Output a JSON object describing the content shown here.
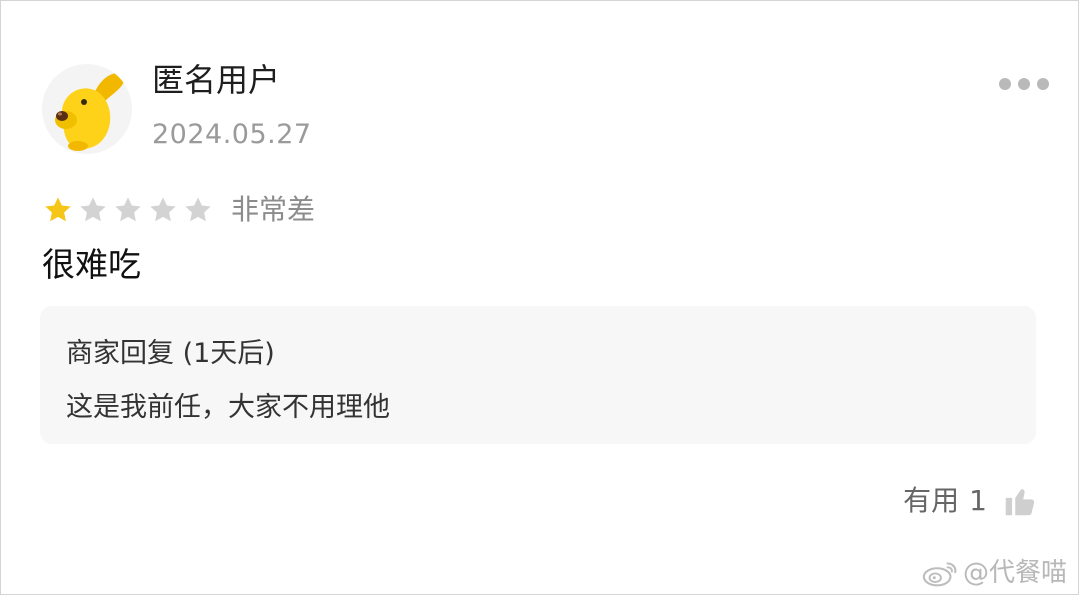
{
  "review": {
    "user_name": "匿名用户",
    "date": "2024.05.27",
    "avatar_icon": "yellow-dog-mascot-icon",
    "more_icon": "more-dots-icon",
    "rating": {
      "filled_stars": 1,
      "total_stars": 5,
      "label": "非常差",
      "filled_color": "#f5c518",
      "empty_color": "#d3d3d3"
    },
    "comment": "很难吃",
    "merchant_reply": {
      "title": "商家回复 (1天后)",
      "text": "这是我前任，大家不用理他"
    },
    "helpful": {
      "label": "有用",
      "count": "1",
      "icon": "thumbs-up-icon"
    }
  },
  "watermark": {
    "text": "@代餐喵",
    "icon": "weibo-icon"
  }
}
